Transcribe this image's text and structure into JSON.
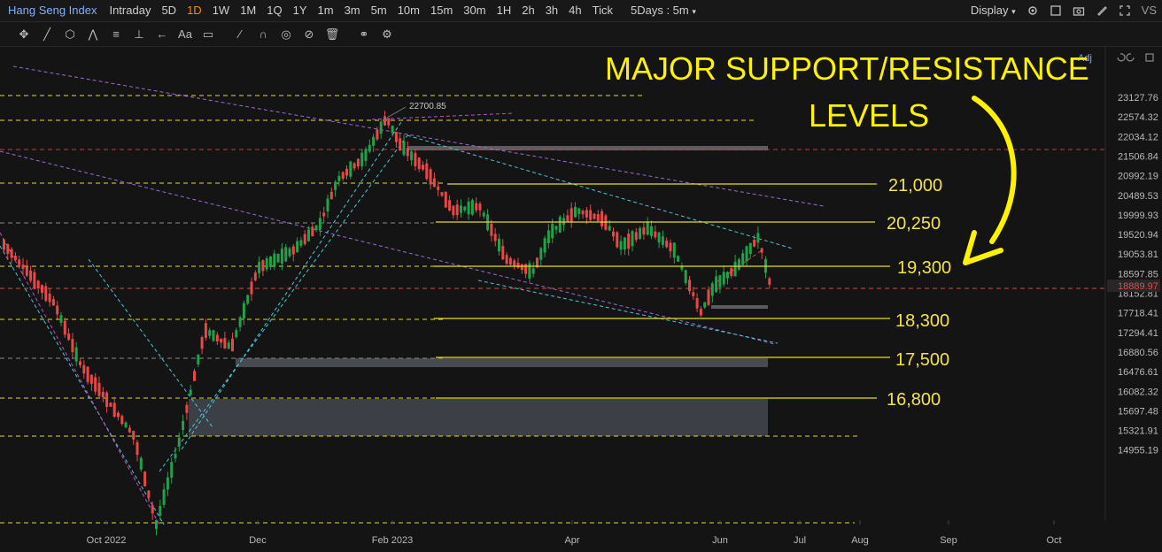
{
  "toolbar": {
    "symbol": "Hang Seng Index",
    "intervals": [
      "Intraday",
      "5D",
      "1D",
      "1W",
      "1M",
      "1Q",
      "1Y",
      "1m",
      "3m",
      "5m",
      "10m",
      "15m",
      "30m",
      "1H",
      "2h",
      "3h",
      "4h",
      "Tick"
    ],
    "active_interval": "1D",
    "range_select": "5Days : 5m",
    "display_label": "Display",
    "brand": "VS"
  },
  "drawing_tools": [
    "crosshair-icon",
    "trend-line-icon",
    "shapes-icon",
    "pattern-icon",
    "fib-icon",
    "vertical-line-icon",
    "arrow-icon",
    "text-icon",
    "note-icon",
    "pen-icon",
    "magnet-icon",
    "eye-icon",
    "hide-icon",
    "trash-icon",
    "link-icon",
    "settings-icon"
  ],
  "chart": {
    "adj_label": "Adj",
    "peak_label": "22700.85",
    "current_price": "18889.97",
    "price_scale": [
      "23127.76",
      "22574.32",
      "22034.12",
      "21506.84",
      "20992.19",
      "20489.53",
      "19999.93",
      "19520.94",
      "19053.81",
      "18597.85",
      "18152.81",
      "17718.41",
      "17294.41",
      "16880.56",
      "16476.61",
      "16082.32",
      "15697.48",
      "15321.91",
      "14955.19"
    ],
    "time_axis": [
      "Oct 2022",
      "Dec",
      "Feb 2023",
      "Apr",
      "Jun",
      "Jul",
      "Aug",
      "Sep",
      "Oct"
    ],
    "annotation_line1": "MAJOR SUPPORT/RESISTANCE",
    "annotation_line2": "LEVELS",
    "levels": [
      "21,000",
      "20,250",
      "19,300",
      "18,300",
      "17,500",
      "16,800"
    ],
    "colors": {
      "up": "#1fa34a",
      "down": "#e84848",
      "support_line": "#e6dd1c",
      "highlight": "#fff200",
      "resistance_red": "#d8343a"
    }
  }
}
